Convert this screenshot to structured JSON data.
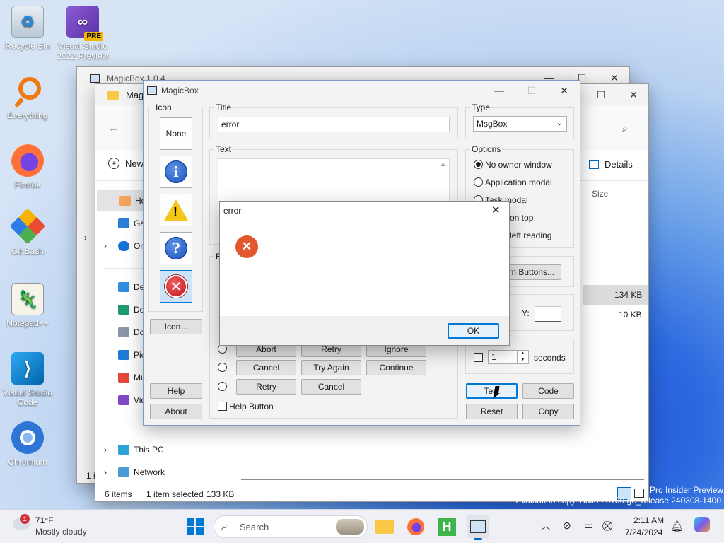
{
  "desktop_icons": [
    {
      "label": "Recycle Bin"
    },
    {
      "label": "Visual Studio 2022 Preview",
      "badge": "PRE"
    },
    {
      "label": "Everything"
    },
    {
      "label": "Firefox"
    },
    {
      "label": "Git Bash"
    },
    {
      "label": "Notepad++"
    },
    {
      "label": "Visual Studio Code"
    },
    {
      "label": "Chromium"
    }
  ],
  "back_window": {
    "title": "MagicBox 1.0.4"
  },
  "explorer": {
    "title": "Mag",
    "new_label": "New",
    "details_label": "Details",
    "col_size": "Size",
    "nav": [
      "Ho",
      "Ga",
      "On",
      "De",
      "Do",
      "Do",
      "Pic",
      "Mu",
      "Vid",
      "This PC",
      "Network"
    ],
    "sizes": [
      "134 KB",
      "10 KB"
    ],
    "status": {
      "items": "6 items",
      "selected": "1 item selected",
      "size": "133 KB"
    },
    "side_stub": "1 i"
  },
  "magicbox": {
    "title": "MagicBox",
    "icon_group": "Icon",
    "none_label": "None",
    "icon_button": "Icon...",
    "help": "Help",
    "about": "About",
    "title_group": "Title",
    "title_value": "error",
    "text_group": "Text",
    "type_group": "Type",
    "type_value": "MsgBox",
    "options_group": "Options",
    "options": [
      "No owner window",
      "Application modal",
      "Task modal",
      "on top",
      "left reading"
    ],
    "custom_buttons": "m Buttons...",
    "y_label": "Y:",
    "seconds_value": "1",
    "seconds_label": "seconds",
    "buttons_group": "B",
    "button_rows": [
      [
        "Abort",
        "Retry",
        "Ignore"
      ],
      [
        "Cancel",
        "Try Again",
        "Continue"
      ],
      [
        "Retry",
        "Cancel"
      ]
    ],
    "help_button_label": "Help Button",
    "actions": {
      "test": "Test",
      "code": "Code",
      "reset": "Reset",
      "copy": "Copy"
    }
  },
  "error_dialog": {
    "title": "error",
    "ok": "OK"
  },
  "taskbar": {
    "weather_temp": "71°F",
    "weather_desc": "Mostly cloudy",
    "weather_badge": "1",
    "search": "Search",
    "time": "2:11 AM",
    "date": "7/24/2024",
    "watermark1": "Pro Insider Preview",
    "watermark2": "Evaluation copy. Build 26100.ge_release.240308-1400"
  }
}
